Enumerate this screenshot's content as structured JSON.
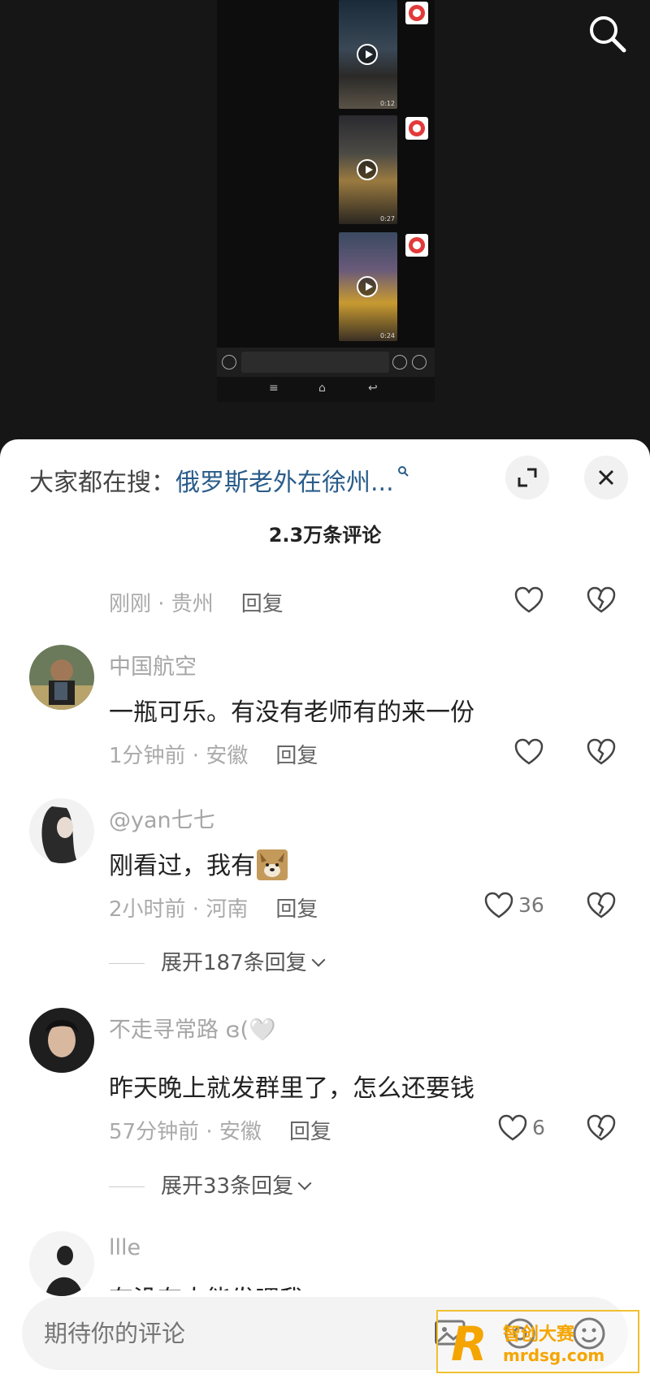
{
  "video": {
    "thumbnails": [
      {
        "duration": "0:12"
      },
      {
        "duration": "0:27"
      },
      {
        "duration": "0:24"
      }
    ]
  },
  "sheet": {
    "trending_label": "大家都在搜：",
    "trending_query": "俄罗斯老外在徐州...",
    "comment_count": "2.3万条评论"
  },
  "comments": [
    {
      "meta": "刚刚 · 贵州",
      "reply": "回复",
      "likes": ""
    },
    {
      "username": "中国航空",
      "text": "一瓶可乐。有没有老师有的来一份",
      "meta": "1分钟前 · 安徽",
      "reply": "回复",
      "likes": ""
    },
    {
      "username": "@yan七七",
      "text": "刚看过，我有",
      "meta": "2小时前 · 河南",
      "reply": "回复",
      "likes": "36",
      "expand": "展开187条回复"
    },
    {
      "username": "不走寻常路 ɞ(🤍",
      "text": "昨天晚上就发群里了，怎么还要钱",
      "meta": "57分钟前 · 安徽",
      "reply": "回复",
      "likes": "6",
      "expand": "展开33条回复"
    },
    {
      "username": "llle",
      "text": "有没有人能发嘿我一"
    }
  ],
  "composer": {
    "placeholder": "期待你的评论"
  },
  "watermark": {
    "brand": "R",
    "line1": "智创大赛",
    "line2": "mrdsg.com"
  },
  "icons": {
    "search": "search-icon",
    "expand": "expand-icon",
    "close": "close-icon",
    "heart": "heart-icon",
    "dislike": "broken-heart-icon",
    "image": "image-icon",
    "at": "at-icon",
    "emoji": "emoji-icon"
  },
  "colors": {
    "link": "#2a5c8a",
    "watermark": "#f5a500",
    "sheet_bg": "#ffffff",
    "video_bg": "#161616"
  }
}
